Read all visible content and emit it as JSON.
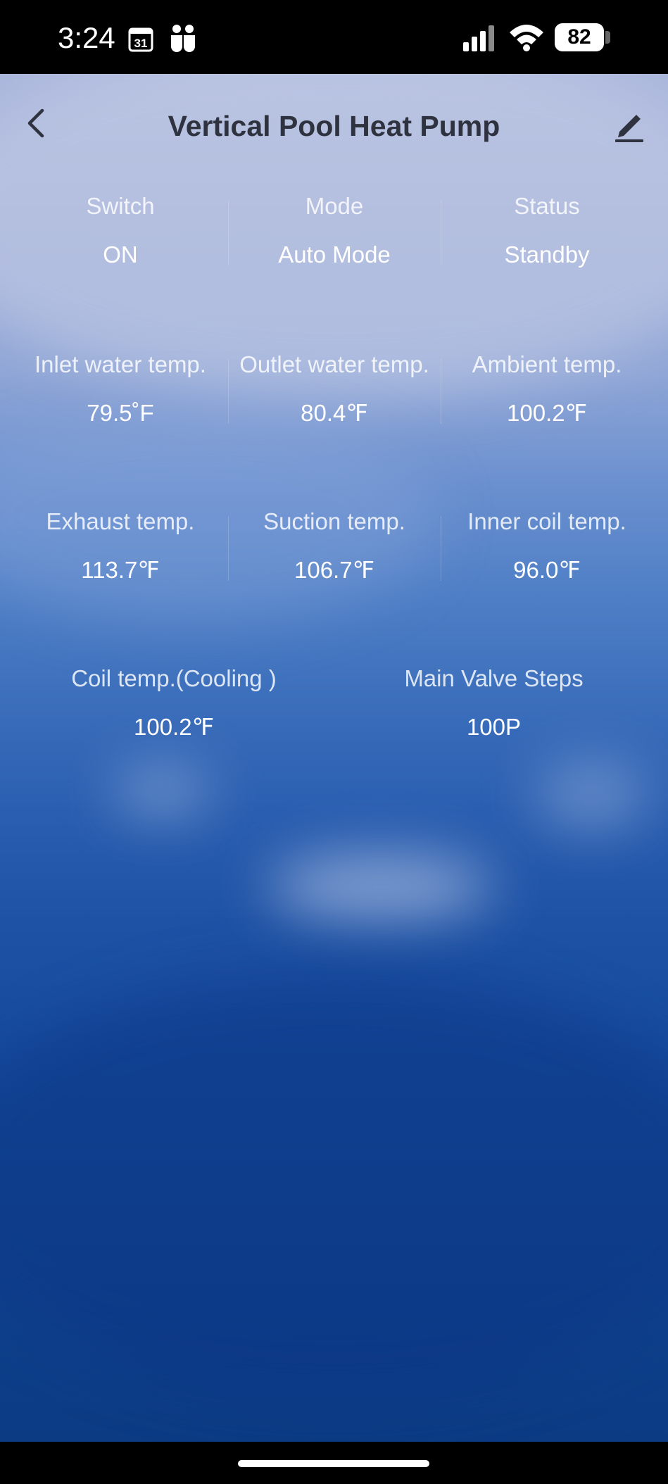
{
  "status_bar": {
    "time": "3:24",
    "calendar_day": "31",
    "battery": "82"
  },
  "header": {
    "title": "Vertical Pool Heat Pump"
  },
  "row1": [
    {
      "label": "Switch",
      "value": "ON"
    },
    {
      "label": "Mode",
      "value": "Auto Mode"
    },
    {
      "label": "Status",
      "value": "Standby"
    }
  ],
  "row2": [
    {
      "label": "Inlet water temp.",
      "value": "79.5˚F"
    },
    {
      "label": "Outlet water temp.",
      "value": "80.4℉"
    },
    {
      "label": "Ambient temp.",
      "value": "100.2℉"
    }
  ],
  "row3": [
    {
      "label": "Exhaust temp.",
      "value": "113.7℉"
    },
    {
      "label": "Suction temp.",
      "value": "106.7℉"
    },
    {
      "label": "Inner coil temp.",
      "value": "96.0℉"
    }
  ],
  "row4": [
    {
      "label": "Coil temp.(Cooling )",
      "value": "100.2℉"
    },
    {
      "label": "Main Valve Steps",
      "value": "100P"
    }
  ],
  "icons": {
    "back": "chevron-left-icon",
    "edit": "pencil-icon",
    "calendar": "calendar-icon",
    "teams": "teams-icon",
    "signal": "signal-icon",
    "wifi": "wifi-icon"
  }
}
